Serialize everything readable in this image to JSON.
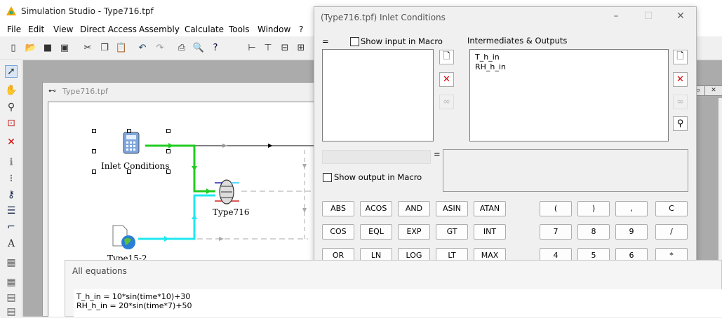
{
  "app": {
    "title": "Simulation Studio - Type716.tpf"
  },
  "menu": [
    "File",
    "Edit",
    "View",
    "Direct Access",
    "Assembly",
    "Calculate",
    "Tools",
    "Window",
    "?"
  ],
  "toolbar_icons": [
    "new-file-icon",
    "open-folder-icon",
    "save-icon",
    "save-all-icon",
    "cut-icon",
    "copy-icon",
    "paste-icon",
    "undo-icon",
    "redo-icon",
    "print-icon",
    "print-preview-icon",
    "help-icon",
    "align-horizontal-icon",
    "align-vertical-icon",
    "distribute-horizontal-icon",
    "distribute-vertical-icon"
  ],
  "left_tools": [
    "pointer-icon",
    "hand-icon",
    "zoom-icon",
    "zoom-window-icon",
    "delete-icon",
    "info-icon",
    "link-icon",
    "key-icon",
    "list-icon",
    "connection-icon",
    "text-icon",
    "grid-icon",
    "grid-icon",
    "grid-icon",
    "grid-icon"
  ],
  "inner_window": {
    "title": "Type716.tpf"
  },
  "diagram": {
    "components": [
      {
        "label": "Inlet Conditions"
      },
      {
        "label": "Type716"
      },
      {
        "label": "Type15-2"
      }
    ],
    "colors": {
      "green": "#22cc22",
      "cyan": "#20e8f0",
      "black": "#000000",
      "gray": "#999999"
    }
  },
  "dialog": {
    "title": "(Type716.tpf) Inlet Conditions",
    "eq_label": "=",
    "show_input": "Show input in Macro",
    "intermediates_label": "Intermediates & Outputs",
    "outputs": [
      "T_h_in",
      "RH_h_in"
    ],
    "show_output": "Show output in Macro",
    "eq_sign": "=",
    "func_rows": [
      [
        "ABS",
        "ACOS",
        "AND",
        "ASIN",
        "ATAN"
      ],
      [
        "COS",
        "EQL",
        "EXP",
        "GT",
        "INT"
      ],
      [
        "OR",
        "LN",
        "LOG",
        "LT",
        "MAX"
      ]
    ],
    "num_rows": [
      [
        "(",
        ")",
        ",",
        "C"
      ],
      [
        "7",
        "8",
        "9",
        "/"
      ],
      [
        "4",
        "5",
        "6",
        "*"
      ]
    ]
  },
  "all_equations": {
    "title": "All equations",
    "lines": [
      "T_h_in = 10*sin(time*10)+30",
      "RH_h_in = 20*sin(time*7)+50"
    ]
  }
}
